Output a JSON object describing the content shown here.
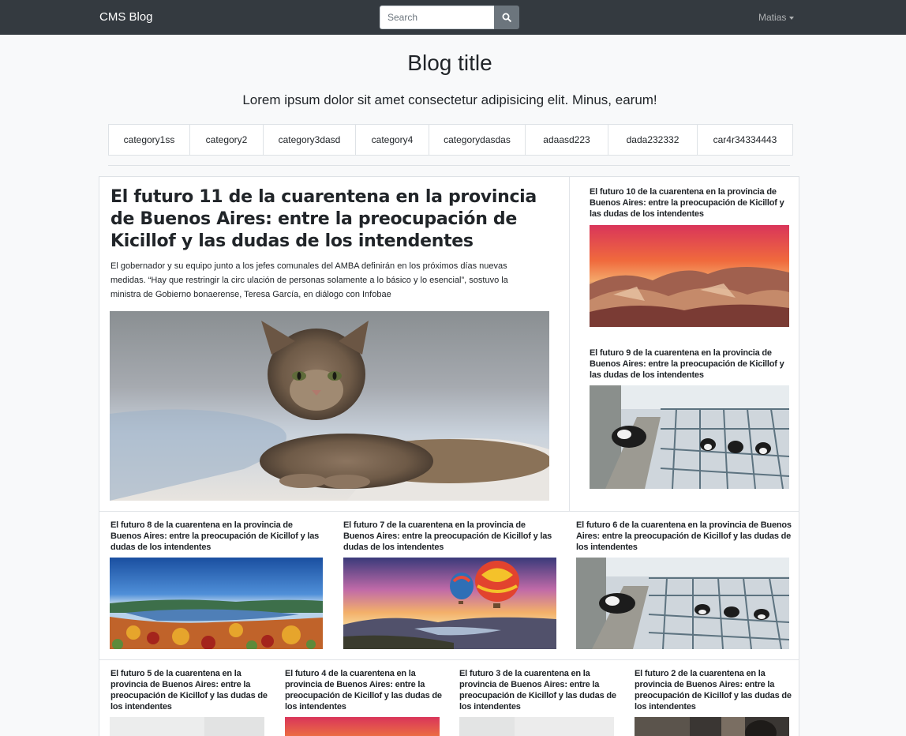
{
  "navbar": {
    "brand": "CMS Blog",
    "search_placeholder": "Search",
    "user": "Matias"
  },
  "header": {
    "title": "Blog title",
    "subtitle": "Lorem ipsum dolor sit amet consectetur adipisicing elit. Minus, earum!"
  },
  "categories": [
    "category1ss",
    "category2",
    "category3dasd",
    "category4",
    "categorydasdas",
    "adaasd223",
    "dada232332",
    "car4r34334443"
  ],
  "featured": {
    "title": "El futuro 11 de la cuarentena en la provincia de Buenos Aires: entre la preocupación de Kicillof y las dudas de los intendentes",
    "excerpt": "El gobernador y su equipo junto a los jefes comunales del AMBA definirán en los próximos días nuevas medidas. “Hay que restringir la circ ulación de personas solamente a lo básico y lo esencial”, sostuvo la ministra de Gobierno bonaerense, Teresa García, en diálogo con Infobae",
    "image": "cat-photo"
  },
  "posts": [
    {
      "title": "El futuro 10 de la cuarentena en la provincia de Buenos Aires: entre la preocupación de Kicillof y las dudas de los intendentes",
      "image": "canyon-sunset"
    },
    {
      "title": "El futuro 9 de la cuarentena en la provincia de Buenos Aires: entre la preocupación de Kicillof y las dudas de los intendentes",
      "image": "dairy-cows"
    },
    {
      "title": "El futuro 8 de la cuarentena en la provincia de Buenos Aires: entre la preocupación de Kicillof y las dudas de los intendentes",
      "image": "autumn-lake"
    },
    {
      "title": "El futuro 7 de la cuarentena en la provincia de Buenos Aires: entre la preocupación de Kicillof y las dudas de los intendentes",
      "image": "hot-air-balloons"
    },
    {
      "title": "El futuro 6 de la cuarentena en la provincia de Buenos Aires: entre la preocupación de Kicillof y las dudas de los intendentes",
      "image": "dairy-cows"
    },
    {
      "title": "El futuro 5 de la cuarentena en la provincia de Buenos Aires: entre la preocupación de Kicillof y las dudas de los intendentes",
      "image": "white-blur"
    },
    {
      "title": "El futuro 4 de la cuarentena en la provincia de Buenos Aires: entre la preocupación de Kicillof y las dudas de los intendentes",
      "image": "canyon-sunset"
    },
    {
      "title": "El futuro 3 de la cuarentena en la provincia de Buenos Aires: entre la preocupación de Kicillof y las dudas de los intendentes",
      "image": "white-blur"
    },
    {
      "title": "El futuro 2 de la cuarentena en la provincia de Buenos Aires: entre la preocupación de Kicillof y las dudas de los intendentes",
      "image": "dark-portrait"
    }
  ]
}
